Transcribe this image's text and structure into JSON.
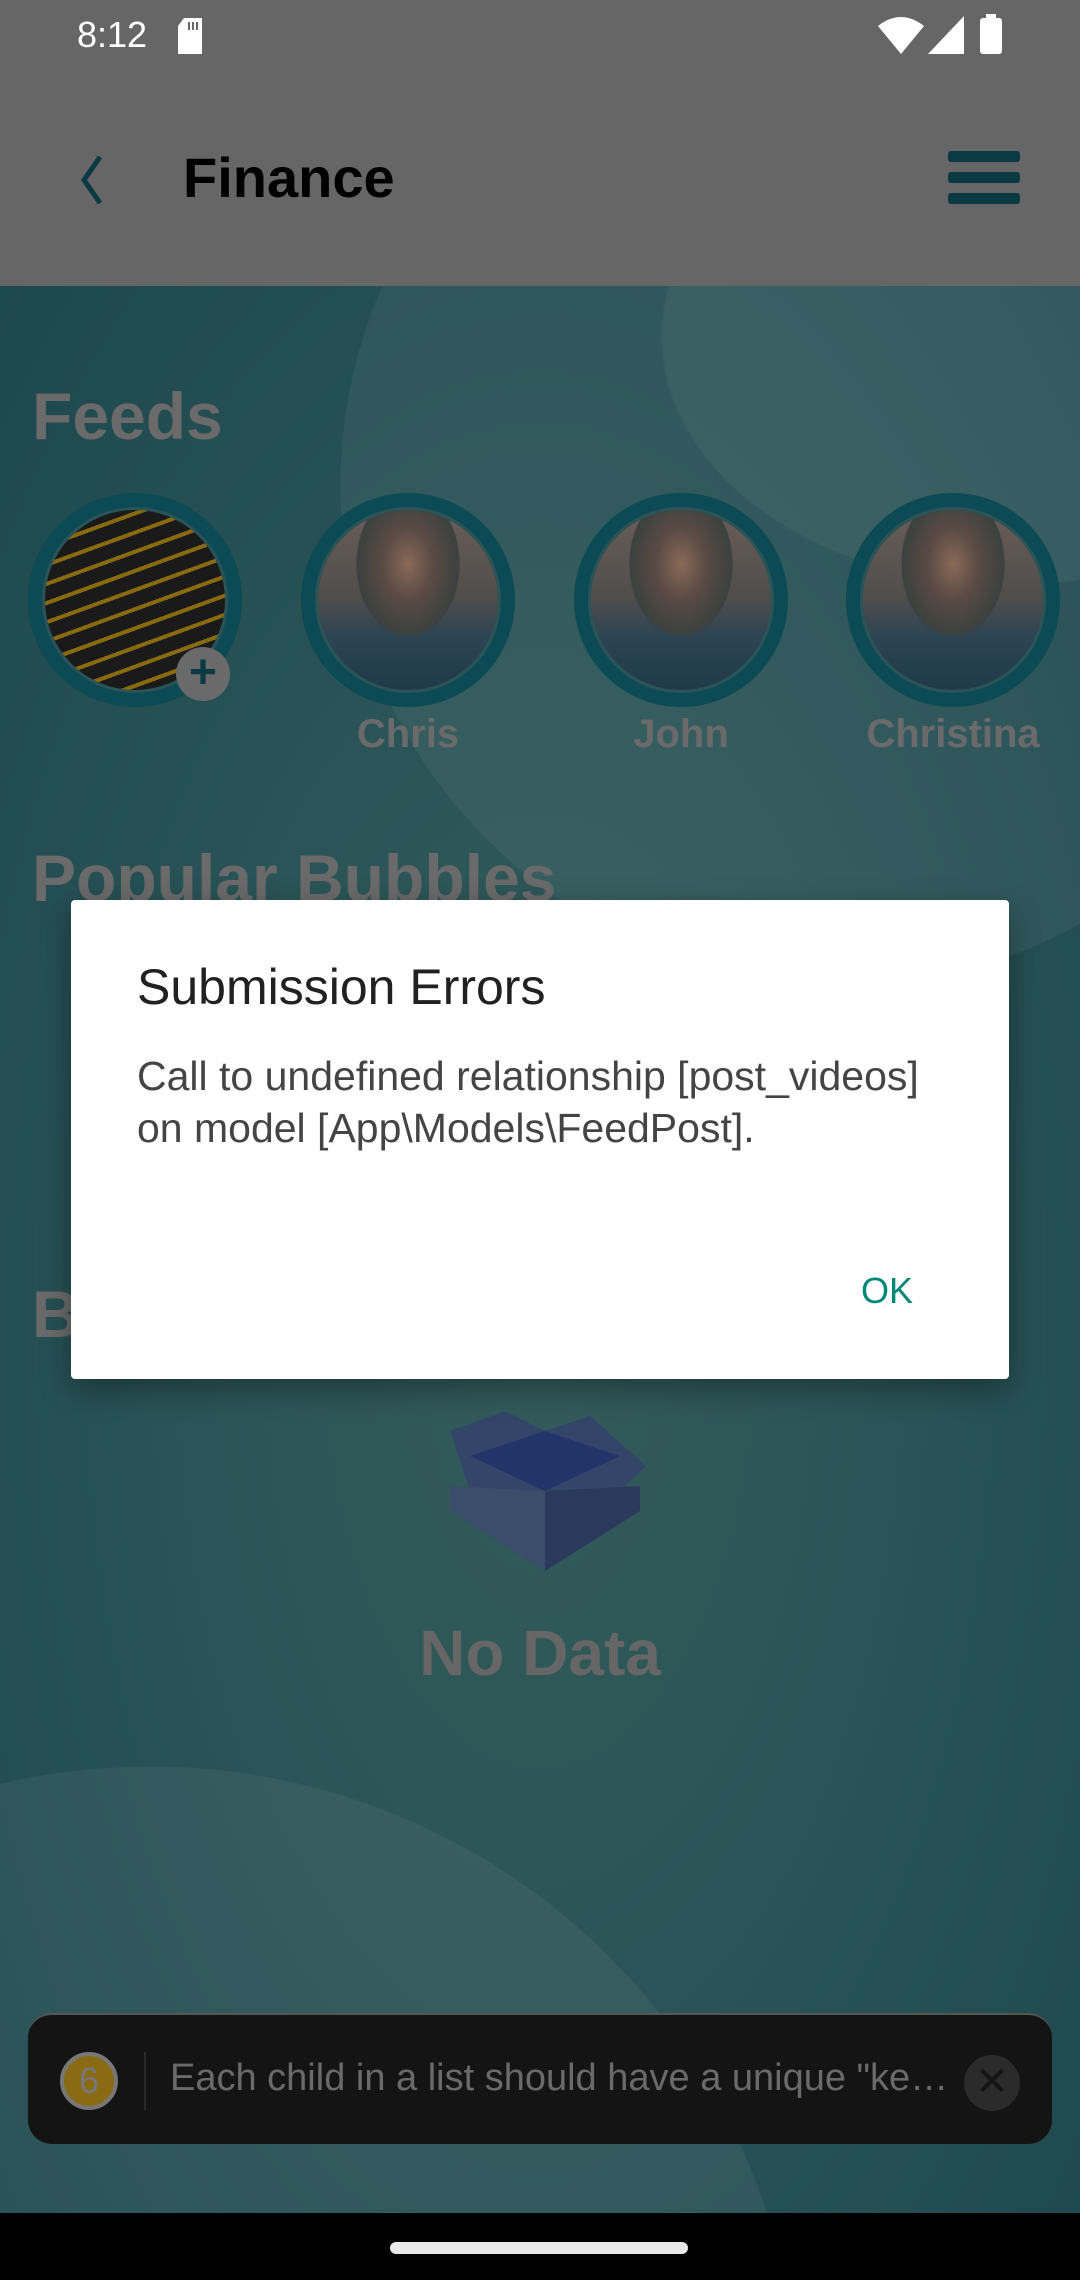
{
  "status_bar": {
    "time": "8:12",
    "icons": [
      "sd-card-icon",
      "wifi-icon",
      "signal-icon",
      "battery-icon"
    ]
  },
  "app_bar": {
    "title": "Finance",
    "back_icon": "chevron-left-icon",
    "menu_icon": "hamburger-menu-icon"
  },
  "feeds": {
    "heading": "Feeds",
    "items": [
      {
        "name": "",
        "image": "stock-board",
        "badge_icon": "plus-icon"
      },
      {
        "name": "Chris",
        "image": "woman-portrait"
      },
      {
        "name": "John",
        "image": "woman-portrait"
      },
      {
        "name": "Christina",
        "image": "woman-portrait"
      }
    ]
  },
  "popular": {
    "heading": "Popular Bubbles"
  },
  "section3": {
    "heading": "B"
  },
  "empty_state": {
    "icon": "open-box-icon",
    "text": "No Data"
  },
  "dialog": {
    "title": "Submission Errors",
    "body": "Call to undefined relationship [post_videos] on model [App\\Models\\FeedPost].",
    "ok_label": "OK"
  },
  "log_box": {
    "count": "6",
    "message": "Each child in a list should have a unique \"ke…",
    "close_icon": "close-icon",
    "badge_color": "#8a6a12"
  },
  "colors": {
    "accent": "#00877a",
    "icon_dark": "#0b3a44"
  }
}
